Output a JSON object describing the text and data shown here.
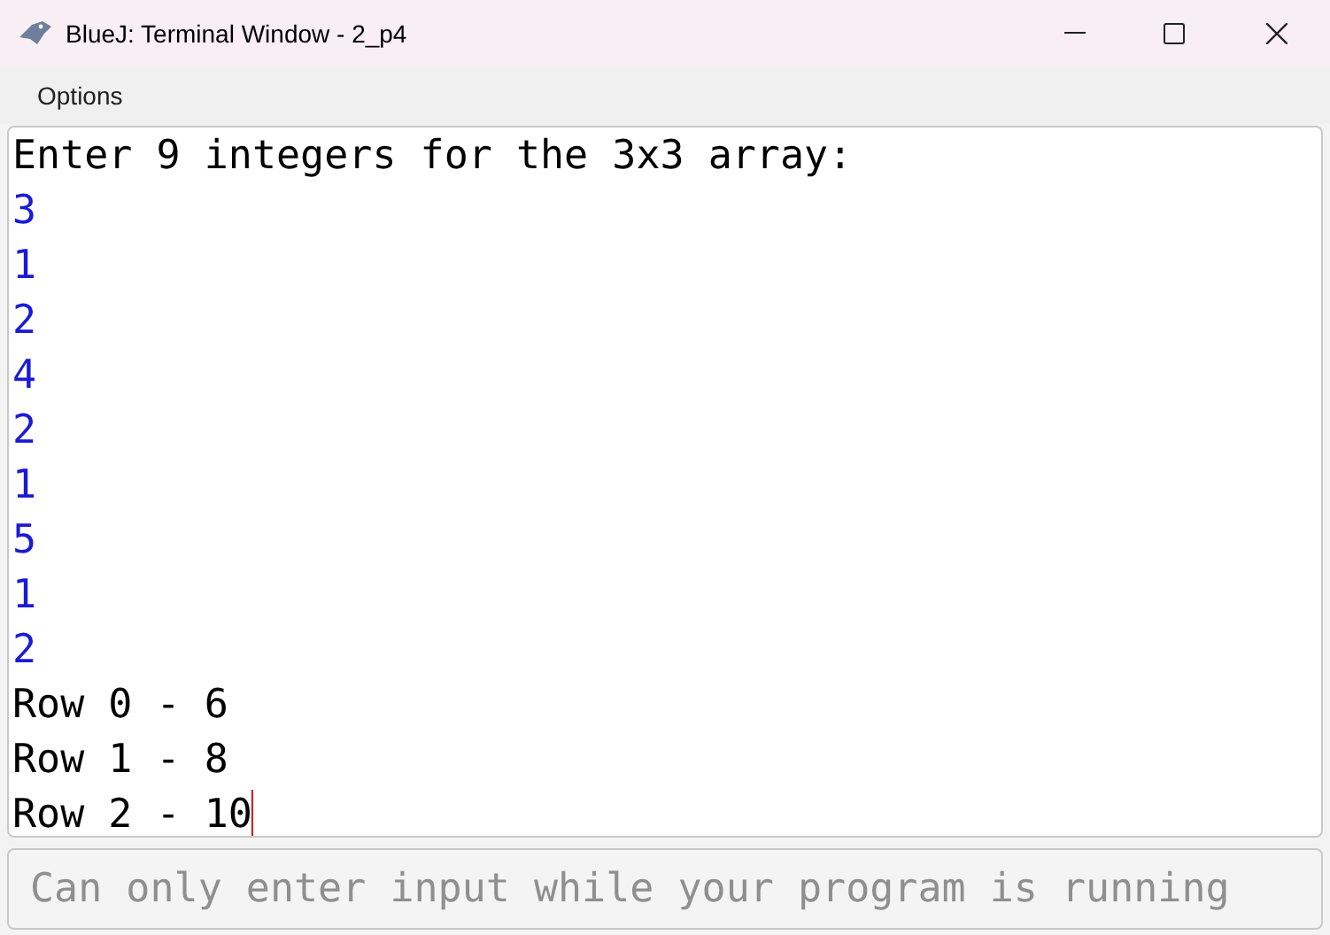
{
  "window": {
    "title": "BlueJ: Terminal Window - 2_p4"
  },
  "menu": [
    "Options"
  ],
  "terminal": {
    "lines": [
      {
        "kind": "output",
        "text": "Enter 9 integers for the 3x3 array:"
      },
      {
        "kind": "input",
        "text": "3"
      },
      {
        "kind": "input",
        "text": "1"
      },
      {
        "kind": "input",
        "text": "2"
      },
      {
        "kind": "input",
        "text": "4"
      },
      {
        "kind": "input",
        "text": "2"
      },
      {
        "kind": "input",
        "text": "1"
      },
      {
        "kind": "input",
        "text": "5"
      },
      {
        "kind": "input",
        "text": "1"
      },
      {
        "kind": "input",
        "text": "2"
      },
      {
        "kind": "output",
        "text": "Row 0 - 6"
      },
      {
        "kind": "output",
        "text": "Row 1 - 8"
      },
      {
        "kind": "output",
        "text": "Row 2 - 10"
      }
    ]
  },
  "input": {
    "placeholder": "Can only enter input while your program is running",
    "disabled": true
  }
}
